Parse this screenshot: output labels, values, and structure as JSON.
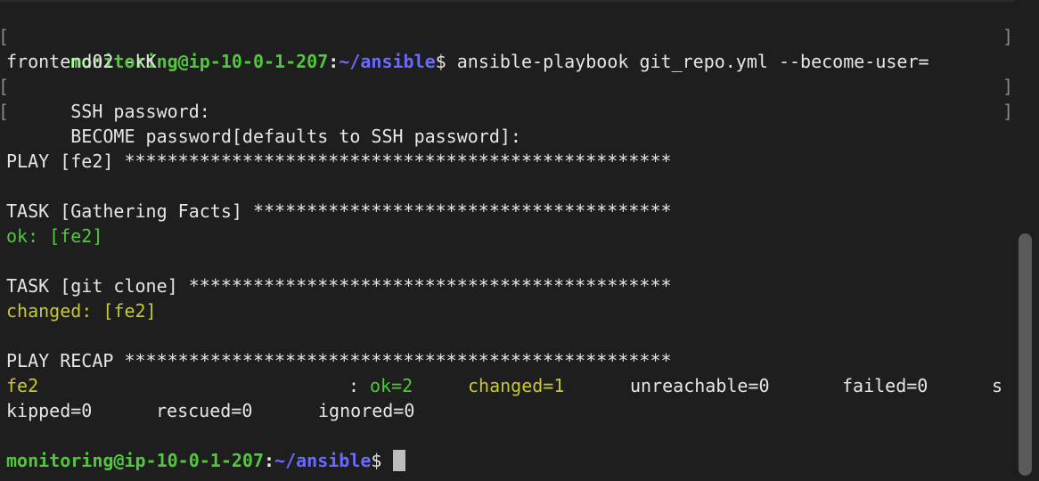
{
  "terminal": {
    "prompt": {
      "user_host": "monitoring@ip-10-0-1-207",
      "colon": ":",
      "path": "~/ansible",
      "dollar": "$"
    },
    "command_part1": " ansible-playbook git_repo.yml --become-user=",
    "command_part2": "frontend02 -kK",
    "ssh_password": "SSH password:",
    "become_password": "BECOME password[defaults to SSH password]:",
    "play_header": "PLAY [fe2] ***************************************************",
    "task1_header": "TASK [Gathering Facts] ***************************************",
    "task1_result": "ok: [fe2]",
    "task2_header": "TASK [git clone] *********************************************",
    "task2_result": "changed: [fe2]",
    "recap_header": "PLAY RECAP ***************************************************",
    "recap": {
      "host": "fe2",
      "colon": ":",
      "ok": "ok=2",
      "changed": "changed=1",
      "unreachable": "unreachable=0",
      "failed": "failed=0",
      "wrap_s": "s",
      "skipped": "kipped=0",
      "rescued": "rescued=0",
      "ignored": "ignored=0"
    },
    "colors": {
      "background": "#1e1e1e",
      "prompt_user": "#4fc93a",
      "prompt_path": "#6a6aff",
      "ok": "#4fc93a",
      "changed": "#c8c832",
      "text": "#e6e6e6"
    }
  }
}
